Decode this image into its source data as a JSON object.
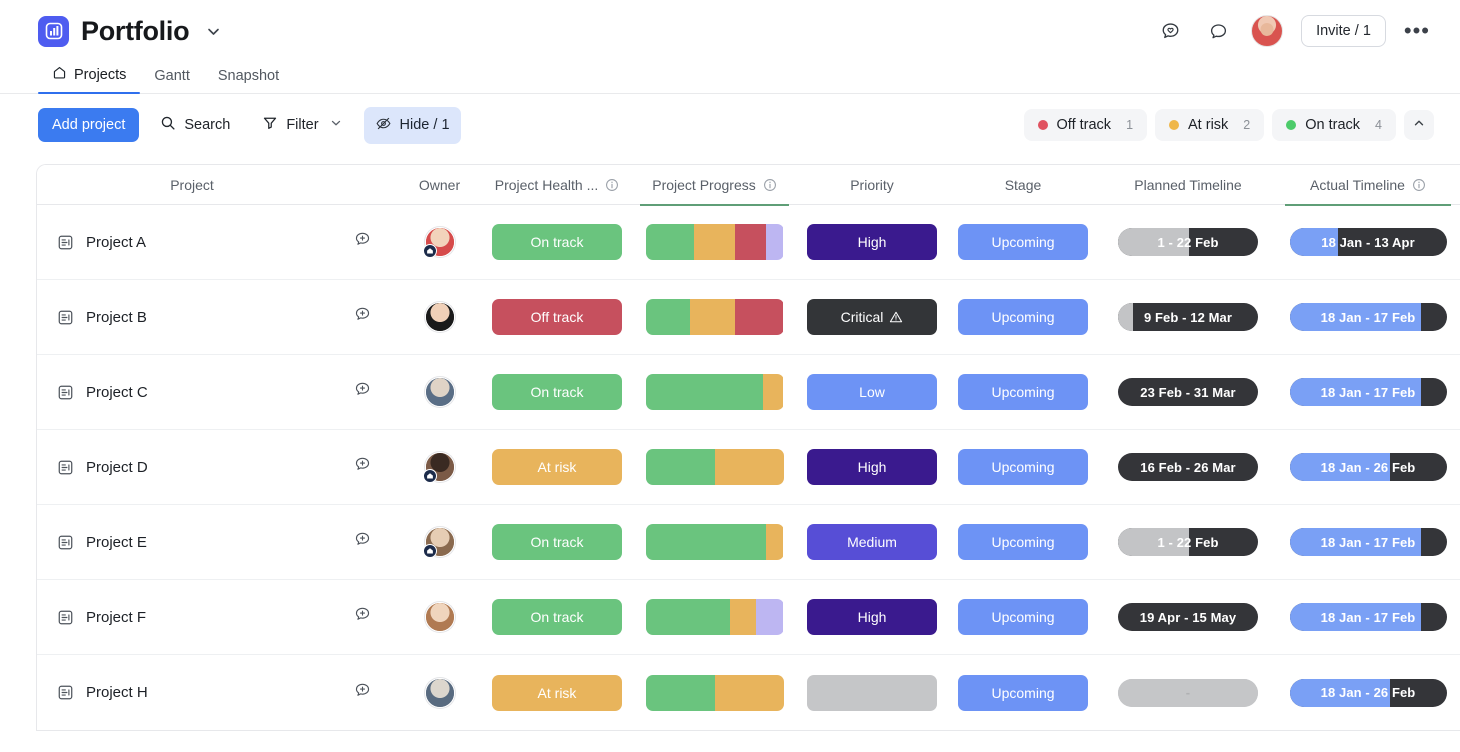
{
  "header": {
    "title": "Portfolio",
    "title_caret": "chevron-down",
    "invite_label": "Invite / 1",
    "icons": [
      "chat-heart-icon",
      "comment-icon"
    ],
    "more_label": "•••"
  },
  "tabs": [
    {
      "label": "Projects",
      "icon": "home-icon",
      "active": true
    },
    {
      "label": "Gantt",
      "icon": "",
      "active": false
    },
    {
      "label": "Snapshot",
      "icon": "",
      "active": false
    }
  ],
  "toolbar": {
    "add_project_label": "Add project",
    "search_label": "Search",
    "filter_label": "Filter",
    "hide_label": "Hide / 1",
    "status_chips": [
      {
        "label": "Off track",
        "count": "1",
        "color": "#e05260"
      },
      {
        "label": "At risk",
        "count": "2",
        "color": "#efb74a"
      },
      {
        "label": "On track",
        "count": "4",
        "color": "#4ccb6a"
      }
    ],
    "collapse_icon": "chevron-up-icon"
  },
  "table": {
    "columns": [
      {
        "label": "Project",
        "info": false,
        "underline": false
      },
      {
        "label": "",
        "info": false,
        "underline": false
      },
      {
        "label": "Owner",
        "info": false,
        "underline": false
      },
      {
        "label": "Project Health ...",
        "info": true,
        "underline": false
      },
      {
        "label": "Project Progress",
        "info": true,
        "underline": true
      },
      {
        "label": "Priority",
        "info": false,
        "underline": false
      },
      {
        "label": "Stage",
        "info": false,
        "underline": false
      },
      {
        "label": "Planned Timeline",
        "info": false,
        "underline": false
      },
      {
        "label": "Actual Timeline",
        "info": true,
        "underline": true
      }
    ],
    "rows": [
      {
        "name": "Project A",
        "avatar_colors": [
          "#f2d3bb",
          "#d64b4b"
        ],
        "health": {
          "label": "On track",
          "color": "#6ac47e"
        },
        "progress": [
          {
            "color": "#6ac47e",
            "pct": 35
          },
          {
            "color": "#e8b45c",
            "pct": 30
          },
          {
            "color": "#c6505e",
            "pct": 22
          },
          {
            "color": "#bdb6f2",
            "pct": 13
          }
        ],
        "priority": {
          "label": "High",
          "color": "#3a1a8e",
          "critical": false
        },
        "stage": {
          "label": "Upcoming",
          "color": "#6d93f5"
        },
        "planned": {
          "label": "1 - 22 Feb",
          "fill_pct": 51,
          "fill_color": "#c3c4c6",
          "track_color": "#343539",
          "empty": false
        },
        "actual": {
          "label": "18 Jan - 13 Apr",
          "fill_pct": 31,
          "fill_color": "#7aa0f5",
          "track_color": "#343539"
        }
      },
      {
        "name": "Project B",
        "avatar_colors": [
          "#f0d0b8",
          "#1a1a1a"
        ],
        "health": {
          "label": "Off track",
          "color": "#c6505e"
        },
        "progress": [
          {
            "color": "#6ac47e",
            "pct": 32
          },
          {
            "color": "#e8b45c",
            "pct": 33
          },
          {
            "color": "#c6505e",
            "pct": 35
          }
        ],
        "priority": {
          "label": "Critical",
          "color": "#333538",
          "critical": true
        },
        "stage": {
          "label": "Upcoming",
          "color": "#6d93f5"
        },
        "planned": {
          "label": "9 Feb - 12 Mar",
          "fill_pct": 11,
          "fill_color": "#c3c4c6",
          "track_color": "#343539",
          "empty": false
        },
        "actual": {
          "label": "18 Jan - 17 Feb",
          "fill_pct": 84,
          "fill_color": "#7aa0f5",
          "track_color": "#343539"
        }
      },
      {
        "name": "Project C",
        "avatar_colors": [
          "#dfd3c6",
          "#5a6e86"
        ],
        "health": {
          "label": "On track",
          "color": "#6ac47e"
        },
        "progress": [
          {
            "color": "#6ac47e",
            "pct": 85
          },
          {
            "color": "#e8b45c",
            "pct": 15
          }
        ],
        "priority": {
          "label": "Low",
          "color": "#6d93f5",
          "critical": false
        },
        "stage": {
          "label": "Upcoming",
          "color": "#6d93f5"
        },
        "planned": {
          "label": "23 Feb - 31 Mar",
          "fill_pct": 0,
          "fill_color": "#c3c4c6",
          "track_color": "#343539",
          "empty": false
        },
        "actual": {
          "label": "18 Jan - 17 Feb",
          "fill_pct": 84,
          "fill_color": "#7aa0f5",
          "track_color": "#343539"
        }
      },
      {
        "name": "Project D",
        "avatar_colors": [
          "#3a2a22",
          "#7b5a46"
        ],
        "health": {
          "label": "At risk",
          "color": "#e8b45c"
        },
        "progress": [
          {
            "color": "#6ac47e",
            "pct": 50
          },
          {
            "color": "#e8b45c",
            "pct": 50
          }
        ],
        "priority": {
          "label": "High",
          "color": "#3a1a8e",
          "critical": false
        },
        "stage": {
          "label": "Upcoming",
          "color": "#6d93f5"
        },
        "planned": {
          "label": "16 Feb - 26 Mar",
          "fill_pct": 0,
          "fill_color": "#c3c4c6",
          "track_color": "#343539",
          "empty": false
        },
        "actual": {
          "label": "18 Jan - 26 Feb",
          "fill_pct": 64,
          "fill_color": "#7aa0f5",
          "track_color": "#343539"
        }
      },
      {
        "name": "Project E",
        "avatar_colors": [
          "#e6cdb4",
          "#8a6a4f"
        ],
        "health": {
          "label": "On track",
          "color": "#6ac47e"
        },
        "progress": [
          {
            "color": "#6ac47e",
            "pct": 87
          },
          {
            "color": "#e8b45c",
            "pct": 13
          }
        ],
        "priority": {
          "label": "Medium",
          "color": "#574ed6",
          "critical": false
        },
        "stage": {
          "label": "Upcoming",
          "color": "#6d93f5"
        },
        "planned": {
          "label": "1 - 22 Feb",
          "fill_pct": 51,
          "fill_color": "#c3c4c6",
          "track_color": "#343539",
          "empty": false
        },
        "actual": {
          "label": "18 Jan - 17 Feb",
          "fill_pct": 84,
          "fill_color": "#7aa0f5",
          "track_color": "#343539"
        }
      },
      {
        "name": "Project F",
        "avatar_colors": [
          "#f0d5bd",
          "#b07a52"
        ],
        "health": {
          "label": "On track",
          "color": "#6ac47e"
        },
        "progress": [
          {
            "color": "#6ac47e",
            "pct": 61
          },
          {
            "color": "#e8b45c",
            "pct": 19
          },
          {
            "color": "#bdb6f2",
            "pct": 20
          }
        ],
        "priority": {
          "label": "High",
          "color": "#3a1a8e",
          "critical": false
        },
        "stage": {
          "label": "Upcoming",
          "color": "#6d93f5"
        },
        "planned": {
          "label": "19 Apr - 15 May",
          "fill_pct": 0,
          "fill_color": "#c3c4c6",
          "track_color": "#343539",
          "empty": false
        },
        "actual": {
          "label": "18 Jan - 17 Feb",
          "fill_pct": 84,
          "fill_color": "#7aa0f5",
          "track_color": "#343539"
        }
      },
      {
        "name": "Project H",
        "avatar_colors": [
          "#dcd6cd",
          "#596b80"
        ],
        "health": {
          "label": "At risk",
          "color": "#e8b45c"
        },
        "progress": [
          {
            "color": "#6ac47e",
            "pct": 50
          },
          {
            "color": "#e8b45c",
            "pct": 50
          }
        ],
        "priority": {
          "label": "",
          "color": "#c5c6c8",
          "critical": false
        },
        "stage": {
          "label": "Upcoming",
          "color": "#6d93f5"
        },
        "planned": {
          "label": "-",
          "fill_pct": 100,
          "fill_color": "#c5c6c8",
          "track_color": "#c5c6c8",
          "empty": true
        },
        "actual": {
          "label": "18 Jan - 26 Feb",
          "fill_pct": 64,
          "fill_color": "#7aa0f5",
          "track_color": "#343539"
        }
      }
    ]
  }
}
